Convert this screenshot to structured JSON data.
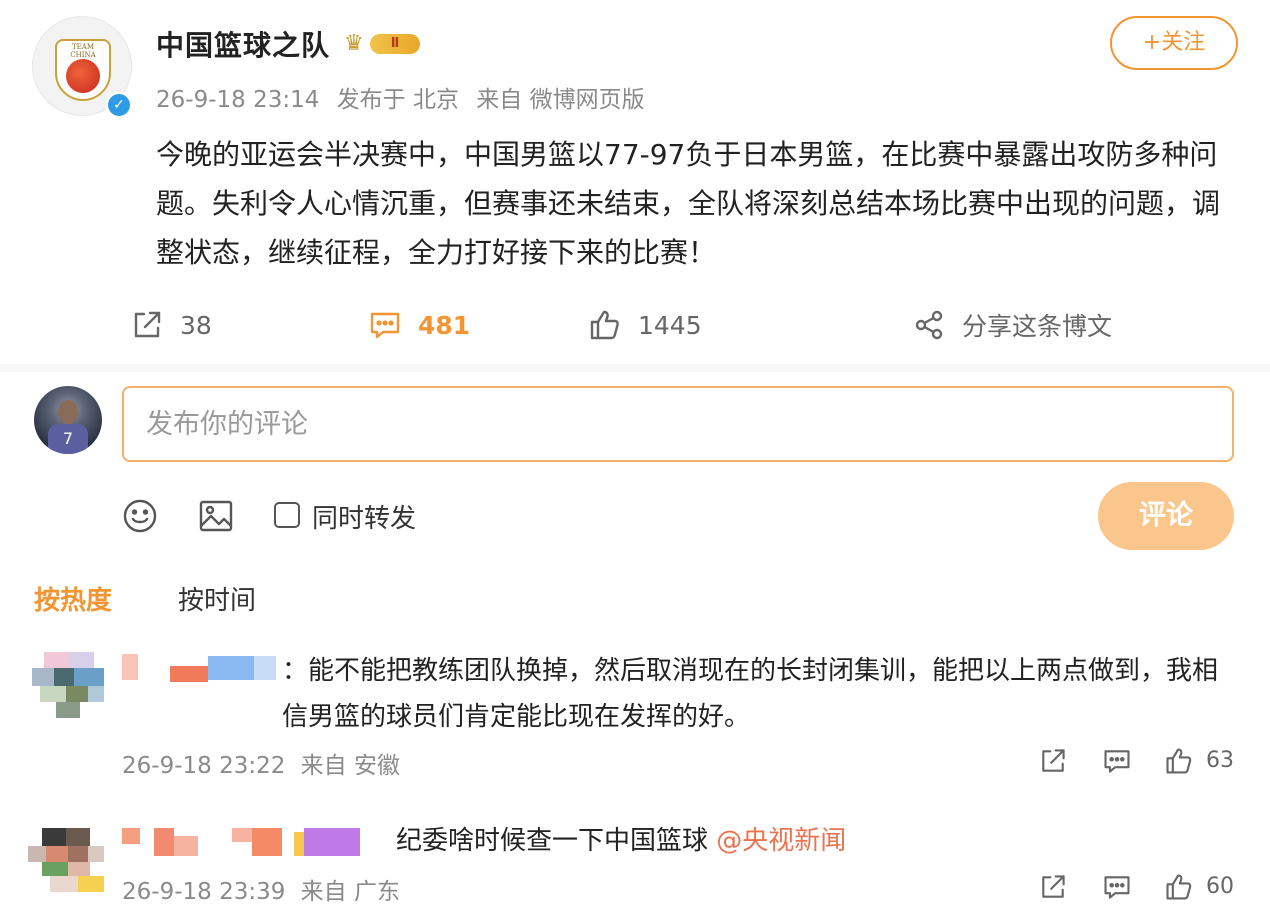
{
  "post": {
    "author_name": "中国篮球之队",
    "avatar_text": "TEAM CHINA",
    "level_badge": "Ⅱ",
    "follow_label": "+关注",
    "meta": {
      "time": "26-9-18 23:14",
      "location": "发布于 北京",
      "source": "来自 微博网页版"
    },
    "text": "今晚的亚运会半决赛中，中国男篮以77-97负于日本男篮，在比赛中暴露出攻防多种问题。失利令人心情沉重，但赛事还未结束，全队将深刻总结本场比赛中出现的问题，调整状态，继续征程，全力打好接下来的比赛！",
    "actions": {
      "repost_count": "38",
      "comment_count": "481",
      "like_count": "1445",
      "share_label": "分享这条博文"
    }
  },
  "compose": {
    "avatar_number": "7",
    "placeholder": "发布你的评论",
    "repost_label": "同时转发",
    "submit_label": "评论"
  },
  "sort": {
    "hot_label": "按热度",
    "time_label": "按时间"
  },
  "comments": [
    {
      "text": "：能不能把教练团队换掉，然后取消现在的长封闭集训，能把以上两点做到，我相信男篮的球员们肯定能比现在发挥的好。",
      "time": "26-9-18 23:22",
      "source": "来自 安徽",
      "like_count": "63"
    },
    {
      "text": "纪委啥时候查一下中国篮球 ",
      "mention": "@央视新闻",
      "time": "26-9-18 23:39",
      "source": "来自 广东",
      "like_count": "60"
    }
  ],
  "colors": {
    "accent": "#f29532",
    "submit_disabled": "#fbc68c",
    "mention": "#eb7350",
    "verified": "#2e9be6"
  },
  "icons": [
    "verified-icon",
    "crown-icon",
    "repost-icon",
    "comment-icon",
    "like-icon",
    "share-icon",
    "emoji-icon",
    "image-icon"
  ]
}
